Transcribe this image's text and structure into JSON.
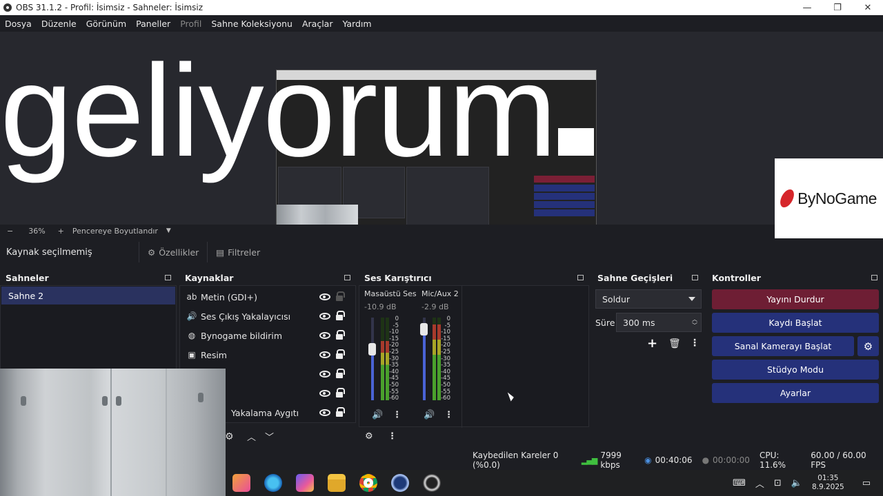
{
  "window": {
    "title": "OBS 31.1.2 - Profil: İsimsiz - Sahneler: İsimsiz",
    "controls": [
      "—",
      "❐",
      "✕"
    ]
  },
  "menu": [
    "Dosya",
    "Düzenle",
    "Görünüm",
    "Paneller",
    "Profil",
    "Sahne Koleksiyonu",
    "Araçlar",
    "Yardım"
  ],
  "preview": {
    "overlay_text": "geliyorum",
    "logo_text": "ByNoGame",
    "zoom_minus": "−",
    "zoom_level": "36%",
    "zoom_plus": "+",
    "fit_mode": "Pencereye Boyutlandır"
  },
  "source_toolbar": {
    "status": "Kaynak seçilmemiş",
    "properties": "Özellikler",
    "filters": "Filtreler"
  },
  "scenes": {
    "title": "Sahneler",
    "items": [
      "Sahne 2"
    ]
  },
  "sources": {
    "title": "Kaynaklar",
    "items": [
      {
        "name": "Metin (GDI+)",
        "icon": "text-icon"
      },
      {
        "name": "Ses Çıkış Yakalayıcısı",
        "icon": "speaker-icon"
      },
      {
        "name": "Bynogame bildirim",
        "icon": "globe-icon"
      },
      {
        "name": "Resim",
        "icon": "image-icon"
      },
      {
        "name": "",
        "icon": ""
      },
      {
        "name": "",
        "icon": ""
      },
      {
        "name": "Yakalama Aygıtı",
        "icon": "camera-icon"
      }
    ]
  },
  "mixer": {
    "title": "Ses Karıştırıcı",
    "channels": [
      {
        "name": "Masaüstü Ses",
        "db": "-10.9 dB",
        "level": 0.72,
        "fader": 0.62
      },
      {
        "name": "Mic/Aux 2",
        "db": "-2.9 dB",
        "level": 0.92,
        "fader": 0.86
      }
    ],
    "scale": [
      "0",
      "-5",
      "-10",
      "-15",
      "-20",
      "-25",
      "-30",
      "-35",
      "-40",
      "-45",
      "-50",
      "-55",
      "-60"
    ]
  },
  "transitions": {
    "title": "Sahne Geçişleri",
    "selected": "Soldur",
    "duration_label": "Süre",
    "duration_value": "300 ms"
  },
  "controls": {
    "title": "Kontroller",
    "stop_stream": "Yayını Durdur",
    "start_record": "Kaydı Başlat",
    "start_virtualcam": "Sanal Kamerayı Başlat",
    "studio_mode": "Stüdyo Modu",
    "settings": "Ayarlar"
  },
  "statusbar": {
    "dropped_frames": "Kaybedilen Kareler 0 (%0.0)",
    "bitrate": "7999 kbps",
    "stream_time": "00:40:06",
    "record_time": "00:00:00",
    "cpu": "CPU: 11.6%",
    "fps": "60.00 / 60.00 FPS"
  },
  "taskbar": {
    "time": "01:35",
    "date": "8.9.2025"
  },
  "colors": {
    "stop_stream": "#6e1e34",
    "blue_button": "#25317a",
    "scene_selected": "#2a325f"
  }
}
